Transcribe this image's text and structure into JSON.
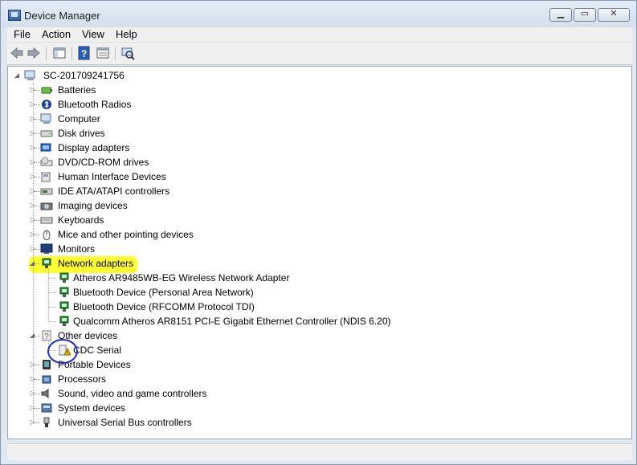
{
  "window": {
    "title": "Device Manager"
  },
  "menu": [
    "File",
    "Action",
    "View",
    "Help"
  ],
  "toolbar": [
    {
      "name": "back-icon"
    },
    {
      "name": "forward-icon"
    },
    {
      "name": "show-hide-console-tree-icon"
    },
    {
      "name": "help-icon"
    },
    {
      "name": "properties-icon"
    },
    {
      "name": "scan-hardware-changes-icon"
    }
  ],
  "tree": {
    "root": "SC-201709241756",
    "categories": [
      {
        "label": "Batteries",
        "icon": "battery-icon"
      },
      {
        "label": "Bluetooth Radios",
        "icon": "bluetooth-icon"
      },
      {
        "label": "Computer",
        "icon": "computer-icon"
      },
      {
        "label": "Disk drives",
        "icon": "disk-drive-icon"
      },
      {
        "label": "Display adapters",
        "icon": "display-adapter-icon"
      },
      {
        "label": "DVD/CD-ROM drives",
        "icon": "dvd-drive-icon"
      },
      {
        "label": "Human Interface Devices",
        "icon": "hid-icon"
      },
      {
        "label": "IDE ATA/ATAPI controllers",
        "icon": "ide-controller-icon"
      },
      {
        "label": "Imaging devices",
        "icon": "camera-icon"
      },
      {
        "label": "Keyboards",
        "icon": "keyboard-icon"
      },
      {
        "label": "Mice and other pointing devices",
        "icon": "mouse-icon"
      },
      {
        "label": "Monitors",
        "icon": "monitor-icon"
      },
      {
        "label": "Network adapters",
        "icon": "network-adapter-icon",
        "expanded": true,
        "children": [
          "Atheros AR9485WB-EG Wireless Network Adapter",
          "Bluetooth Device (Personal Area Network)",
          "Bluetooth Device (RFCOMM Protocol TDI)",
          "Qualcomm Atheros AR8151 PCI-E Gigabit Ethernet Controller (NDIS 6.20)"
        ]
      },
      {
        "label": "Other devices",
        "icon": "unknown-device-icon",
        "expanded": true,
        "children": [
          "CDC Serial"
        ]
      },
      {
        "label": "Portable Devices",
        "icon": "portable-device-icon"
      },
      {
        "label": "Processors",
        "icon": "processor-icon"
      },
      {
        "label": "Sound, video and game controllers",
        "icon": "speaker-icon"
      },
      {
        "label": "System devices",
        "icon": "system-device-icon"
      },
      {
        "label": "Universal Serial Bus controllers",
        "icon": "usb-icon"
      }
    ]
  },
  "colors": {
    "highlight": "#ffff33",
    "annotation_circle": "#1f2cc9"
  }
}
